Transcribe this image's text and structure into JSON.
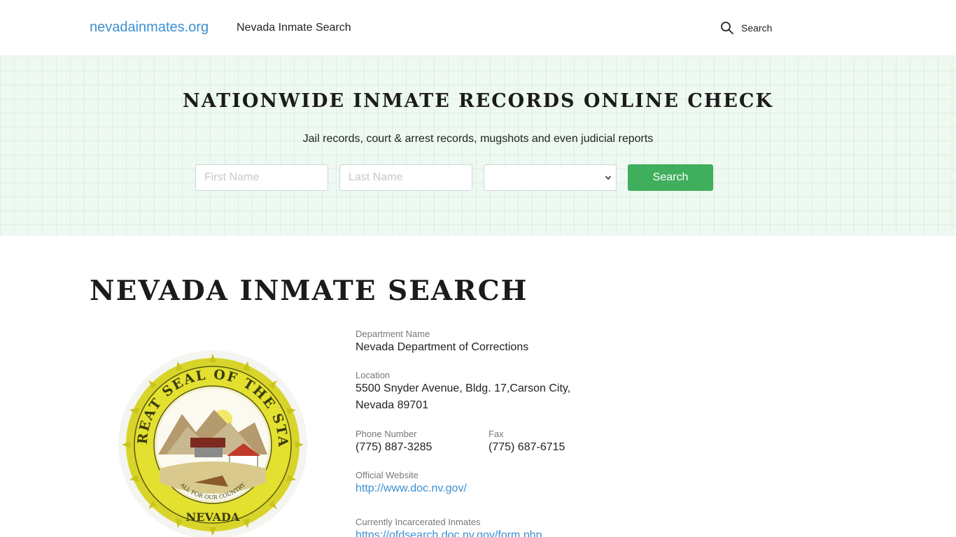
{
  "header": {
    "logo": "nevadainmates.org",
    "nav_link": "Nevada Inmate Search",
    "search_label": "Search"
  },
  "hero": {
    "title": "NATIONWIDE INMATE RECORDS ONLINE CHECK",
    "subtitle": "Jail records, court & arrest records, mugshots and even judicial reports",
    "first_name_placeholder": "First Name",
    "last_name_placeholder": "Last Name",
    "state_value": "",
    "search_button": "Search"
  },
  "main": {
    "title": "NEVADA INMATE SEARCH",
    "seal": {
      "top_text": "THE GREAT SEAL OF THE STATE OF",
      "motto": "ALL FOR OUR COUNTRY",
      "bottom_text": "NEVADA"
    },
    "department": {
      "label": "Department Name",
      "value": "Nevada Department of Corrections"
    },
    "location": {
      "label": "Location",
      "line1": "5500 Snyder Avenue, Bldg. 17,Carson City,",
      "line2": "Nevada 89701"
    },
    "phone": {
      "label": "Phone Number",
      "value": "(775) 887-3285"
    },
    "fax": {
      "label": "Fax",
      "value": "(775) 687-6715"
    },
    "website": {
      "label": "Official Website",
      "value": "http://www.doc.nv.gov/"
    },
    "inmates": {
      "label": "Currently Incarcerated Inmates",
      "value": "https://ofdsearch.doc.nv.gov/form.php"
    }
  },
  "colors": {
    "accent_blue": "#3d8fd1",
    "button_green": "#3fae5d",
    "hero_bg": "#eef9f1"
  }
}
